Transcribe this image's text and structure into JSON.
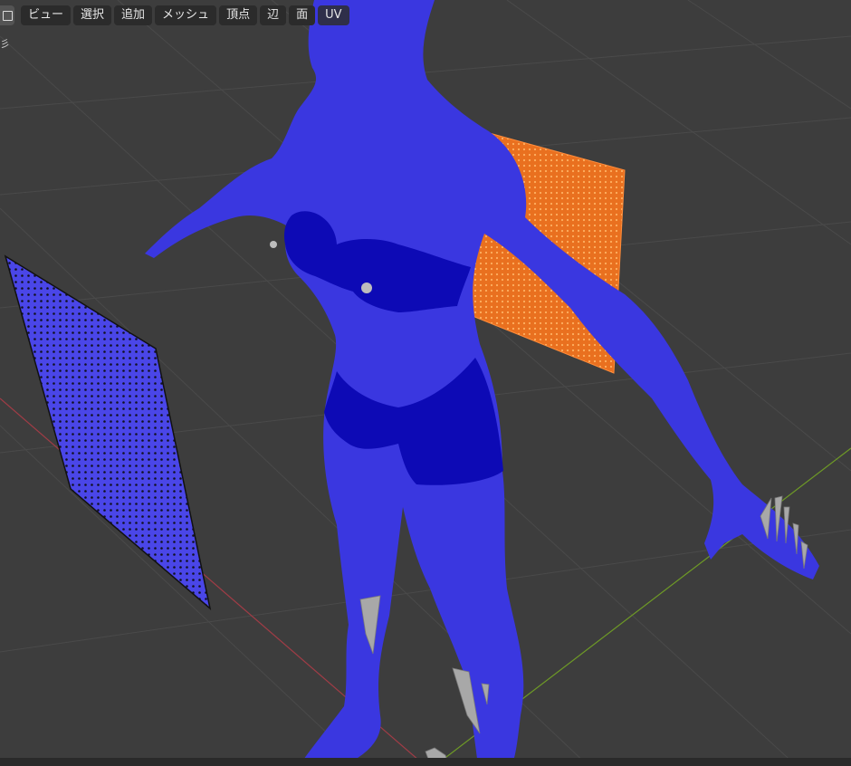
{
  "header": {
    "mode_icon": "edit-mode-cube-icon",
    "menus": [
      {
        "label": "ビュー"
      },
      {
        "label": "選択"
      },
      {
        "label": "追加"
      },
      {
        "label": "メッシュ"
      },
      {
        "label": "頂点"
      },
      {
        "label": "辺"
      },
      {
        "label": "面"
      },
      {
        "label": "UV"
      }
    ]
  },
  "viewport": {
    "side_text": "彡",
    "colors": {
      "background": "#3d3d3d",
      "grid": "#4a4a4a",
      "mesh_blue": "#3a37e0",
      "mesh_dark_blue": "#0d0ab5",
      "plane_orange": "#f07a2c",
      "plane_blue": "#4b47e6",
      "x_axis": "#a03c46",
      "y_axis": "#6e9a26",
      "bone_gray": "#a8a8a8"
    },
    "objects": [
      {
        "name": "character-body",
        "kind": "mesh"
      },
      {
        "name": "orange-plane",
        "kind": "mesh-grid"
      },
      {
        "name": "blue-plane",
        "kind": "mesh-grid"
      }
    ]
  }
}
